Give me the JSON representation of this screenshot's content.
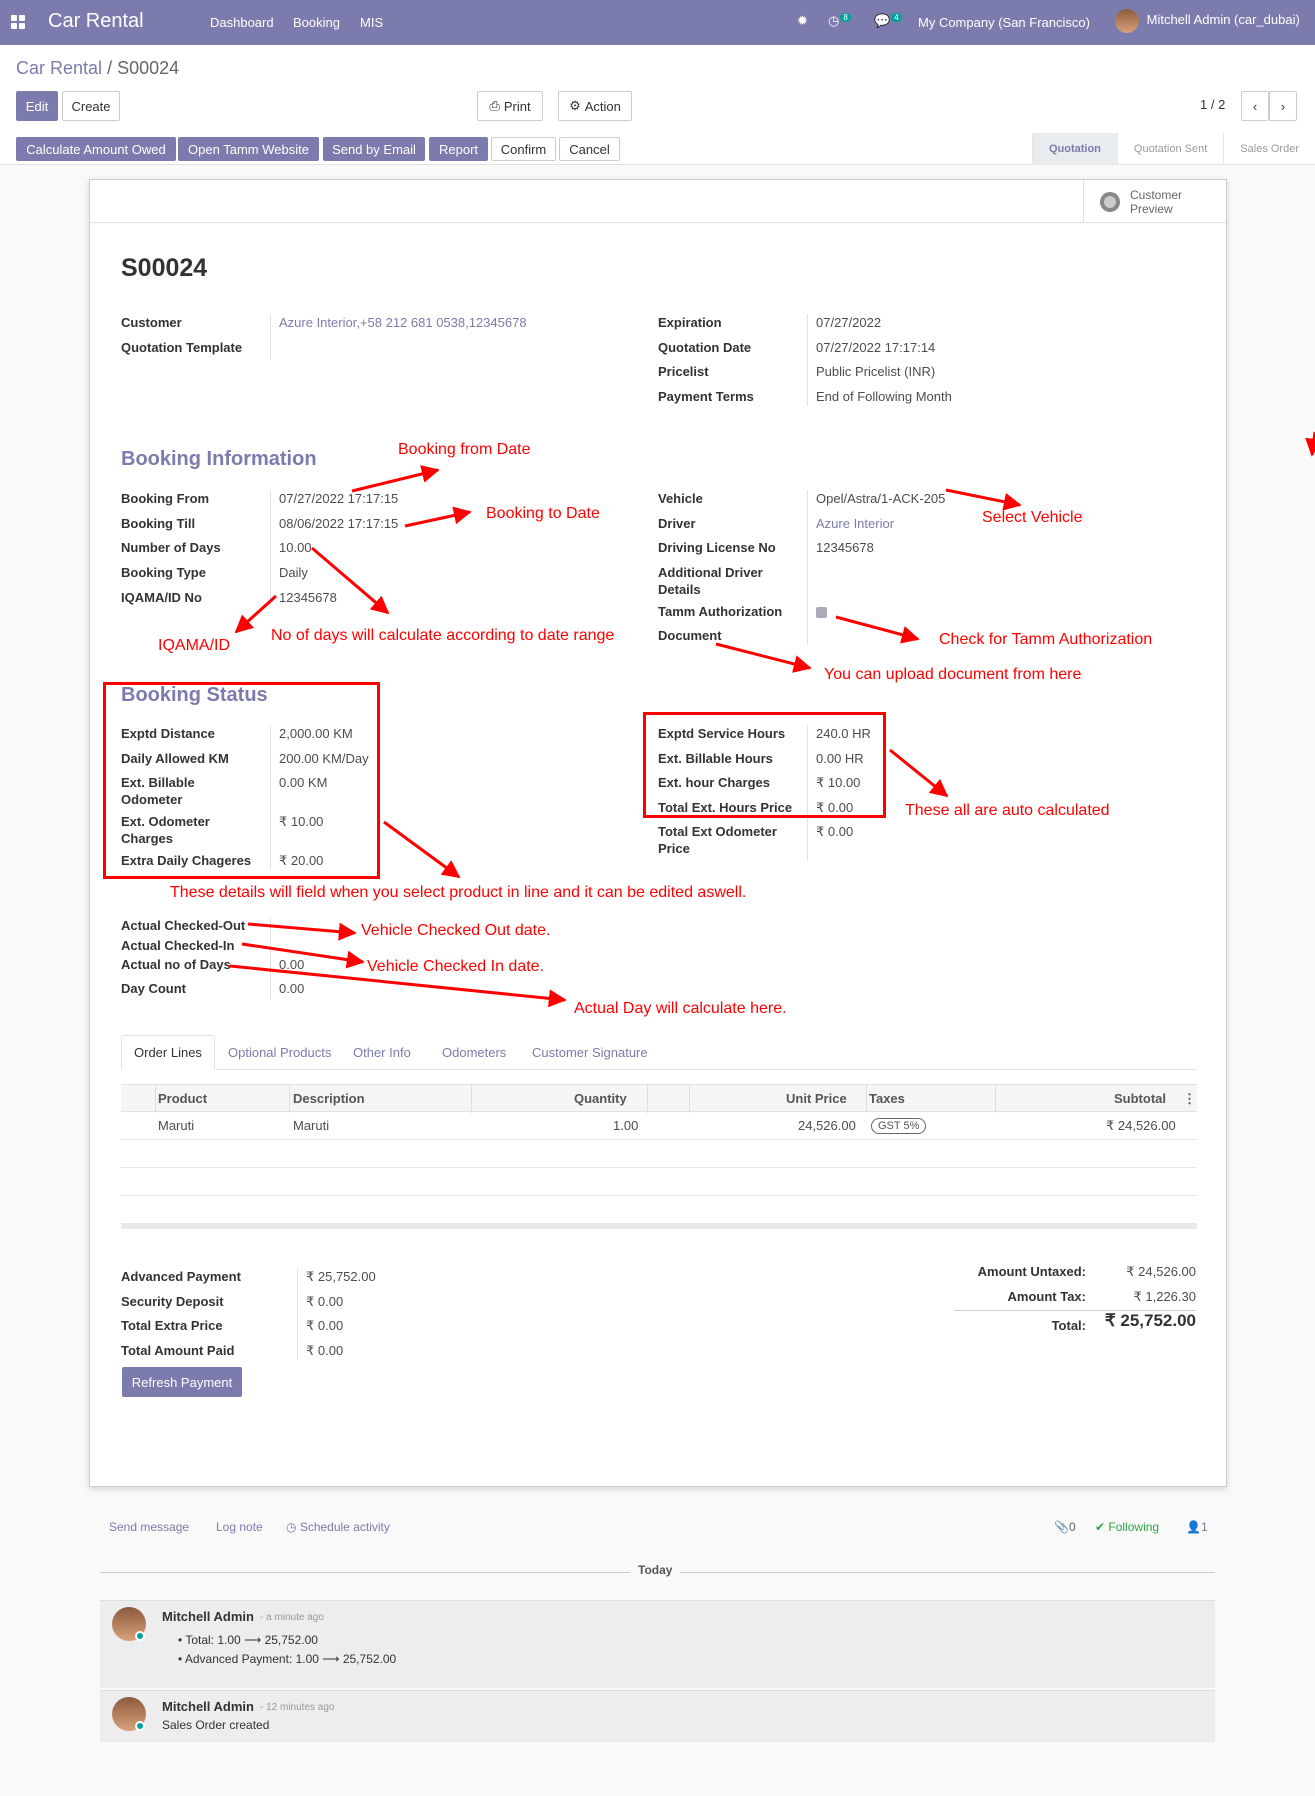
{
  "nav": {
    "app_title": "Car Rental",
    "menus": [
      "Dashboard",
      "Booking",
      "MIS"
    ],
    "activity_count": "8",
    "message_count": "4",
    "company": "My Company (San Francisco)",
    "user": "Mitchell Admin (car_dubai)"
  },
  "breadcrumb": {
    "parent": "Car Rental",
    "sep": "/",
    "current": "S00024"
  },
  "control": {
    "edit": "Edit",
    "create": "Create",
    "print": "Print",
    "action": "Action",
    "pager": "1 / 2",
    "buttons": [
      "Calculate Amount Owed",
      "Open Tamm Website",
      "Send by Email",
      "Report",
      "Confirm",
      "Cancel"
    ],
    "stages": [
      "Quotation",
      "Quotation Sent",
      "Sales Order"
    ]
  },
  "sheet": {
    "customer_preview": [
      "Customer",
      "Preview"
    ],
    "title": "S00024",
    "left_fields": [
      {
        "label": "Customer",
        "value": "Azure Interior,+58 212 681 0538,12345678"
      },
      {
        "label": "Quotation Template",
        "value": ""
      }
    ],
    "right_fields": [
      {
        "label": "Expiration",
        "value": "07/27/2022"
      },
      {
        "label": "Quotation Date",
        "value": "07/27/2022 17:17:14"
      },
      {
        "label": "Pricelist",
        "value": "Public Pricelist (INR)"
      },
      {
        "label": "Payment Terms",
        "value": "End of Following Month"
      }
    ],
    "booking_info_title": "Booking Information",
    "booking_left": [
      {
        "label": "Booking From",
        "value": "07/27/2022 17:17:15"
      },
      {
        "label": "Booking Till",
        "value": "08/06/2022 17:17:15"
      },
      {
        "label": "Number of Days",
        "value": "10.00"
      },
      {
        "label": "Booking Type",
        "value": "Daily"
      },
      {
        "label": "IQAMA/ID No",
        "value": "12345678"
      }
    ],
    "booking_right": [
      {
        "label": "Vehicle",
        "value": "Opel/Astra/1-ACK-205"
      },
      {
        "label": "Driver",
        "value": "Azure Interior"
      },
      {
        "label": "Driving License No",
        "value": "12345678"
      },
      {
        "label": "Additional Driver",
        "label2": "Details",
        "value": ""
      },
      {
        "label": "Tamm Authorization",
        "value": ""
      },
      {
        "label": "Document",
        "value": ""
      }
    ],
    "booking_status_title": "Booking Status",
    "status_left": [
      {
        "label": "Exptd Distance",
        "value": "2,000.00 KM"
      },
      {
        "label": "Daily Allowed KM",
        "value": "200.00 KM/Day"
      },
      {
        "label": "Ext. Billable",
        "label2": "Odometer",
        "value": "0.00 KM"
      },
      {
        "label": "Ext. Odometer",
        "label2": "Charges",
        "value": "₹ 10.00"
      },
      {
        "label": "Extra Daily Chageres",
        "value": "₹ 20.00"
      }
    ],
    "status_right": [
      {
        "label": "Exptd Service Hours",
        "value": "240.0 HR"
      },
      {
        "label": "Ext. Billable Hours",
        "value": "0.00 HR"
      },
      {
        "label": "Ext. hour Charges",
        "value": "₹ 10.00"
      },
      {
        "label": "Total Ext. Hours Price",
        "value": "₹ 0.00"
      },
      {
        "label": "Total Ext Odometer",
        "label2": "Price",
        "value": "₹ 0.00"
      }
    ],
    "actual_fields": [
      {
        "label": "Actual Checked-Out",
        "value": ""
      },
      {
        "label": "Actual Checked-In",
        "value": ""
      },
      {
        "label": "Actual no of Days",
        "value": "0.00"
      },
      {
        "label": "Day Count",
        "value": "0.00"
      }
    ],
    "tabs": [
      "Order Lines",
      "Optional Products",
      "Other Info",
      "Odometers",
      "Customer Signature"
    ],
    "table_headers": [
      "Product",
      "Description",
      "Quantity",
      "Unit Price",
      "Taxes",
      "Subtotal"
    ],
    "rows": [
      {
        "product": "Maruti",
        "description": "Maruti",
        "quantity": "1.00",
        "unit_price": "24,526.00",
        "tax": "GST 5%",
        "subtotal": "₹ 24,526.00"
      }
    ],
    "payments": [
      {
        "label": "Advanced Payment",
        "value": "₹ 25,752.00"
      },
      {
        "label": "Security Deposit",
        "value": "₹ 0.00"
      },
      {
        "label": "Total Extra Price",
        "value": "₹ 0.00"
      },
      {
        "label": "Total Amount Paid",
        "value": "₹ 0.00"
      }
    ],
    "refresh_button": "Refresh Payment",
    "totals": [
      {
        "label": "Amount Untaxed:",
        "value": "₹ 24,526.00"
      },
      {
        "label": "Amount Tax:",
        "value": "₹ 1,226.30"
      },
      {
        "label": "Total:",
        "value": "₹ 25,752.00"
      }
    ]
  },
  "annotations": {
    "booking_from": "Booking from Date",
    "booking_to": "Booking to Date",
    "select_vehicle": "Select Vehicle",
    "days": "No of days will calculate according to date range",
    "iqama": "IQAMA/ID",
    "tamm": "Check for Tamm Authorization",
    "document": "You can upload document from here",
    "auto": "These all are auto calculated",
    "details": "These details will field when you select product in line and it can be edited aswell.",
    "checked_out": "Vehicle Checked Out date.",
    "checked_in": "Vehicle Checked In date.",
    "actual_day": "Actual Day will calculate here."
  },
  "chatter": {
    "send_message": "Send message",
    "log_note": "Log note",
    "schedule": "Schedule activity",
    "attachments": "0",
    "following": "Following",
    "followers": "1",
    "today": "Today",
    "messages": [
      {
        "author": "Mitchell Admin",
        "time": "- a minute ago",
        "lines": [
          "Total: 1.00 ⟶ 25,752.00",
          "Advanced Payment: 1.00 ⟶ 25,752.00"
        ]
      },
      {
        "author": "Mitchell Admin",
        "time": "- 12 minutes ago",
        "lines": [
          "Sales Order created"
        ]
      }
    ]
  },
  "colors": {
    "brand": "#7c7bad",
    "annotation": "#ff0000",
    "online": "#00a09d",
    "following": "#28a745"
  },
  "icons": [
    "apps-icon",
    "bug-icon",
    "clock-icon",
    "chat-icon",
    "print-icon",
    "gear-icon",
    "chevron-left-icon",
    "chevron-right-icon",
    "globe-icon",
    "paperclip-icon",
    "check-icon",
    "user-icon"
  ]
}
